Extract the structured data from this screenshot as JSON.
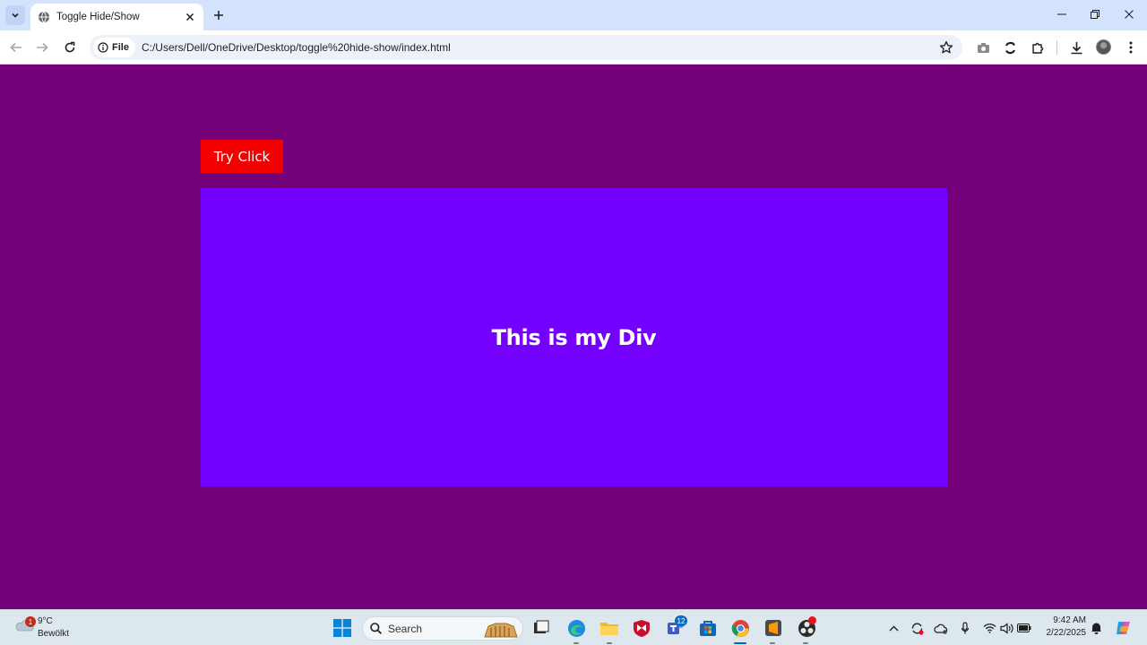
{
  "browser": {
    "tab_title": "Toggle Hide/Show",
    "address_chip": "File",
    "url": "C:/Users/Dell/OneDrive/Desktop/toggle%20hide-show/index.html"
  },
  "page": {
    "background_color": "#74007a",
    "button_label": "Try Click",
    "button_color": "#f30000",
    "div_text": "This is my Div",
    "div_color": "#7400ff"
  },
  "taskbar": {
    "weather_temp": "9°C",
    "weather_condition": "Bewölkt",
    "weather_badge": "1",
    "search_label": "Search",
    "teams_badge": "12",
    "time": "9:42 AM",
    "date": "2/22/2025",
    "icons": [
      "windows-start-icon",
      "search-icon",
      "task-view-icon",
      "edge-icon",
      "file-explorer-icon",
      "mcafee-icon",
      "teams-icon",
      "store-icon",
      "chrome-icon",
      "sublime-text-icon",
      "obs-icon"
    ],
    "tray_icons": [
      "chevron-up-icon",
      "sync-icon",
      "cloud-icon",
      "microphone-icon",
      "wifi-icon",
      "volume-icon",
      "battery-icon",
      "bell-icon",
      "copilot-icon"
    ]
  }
}
